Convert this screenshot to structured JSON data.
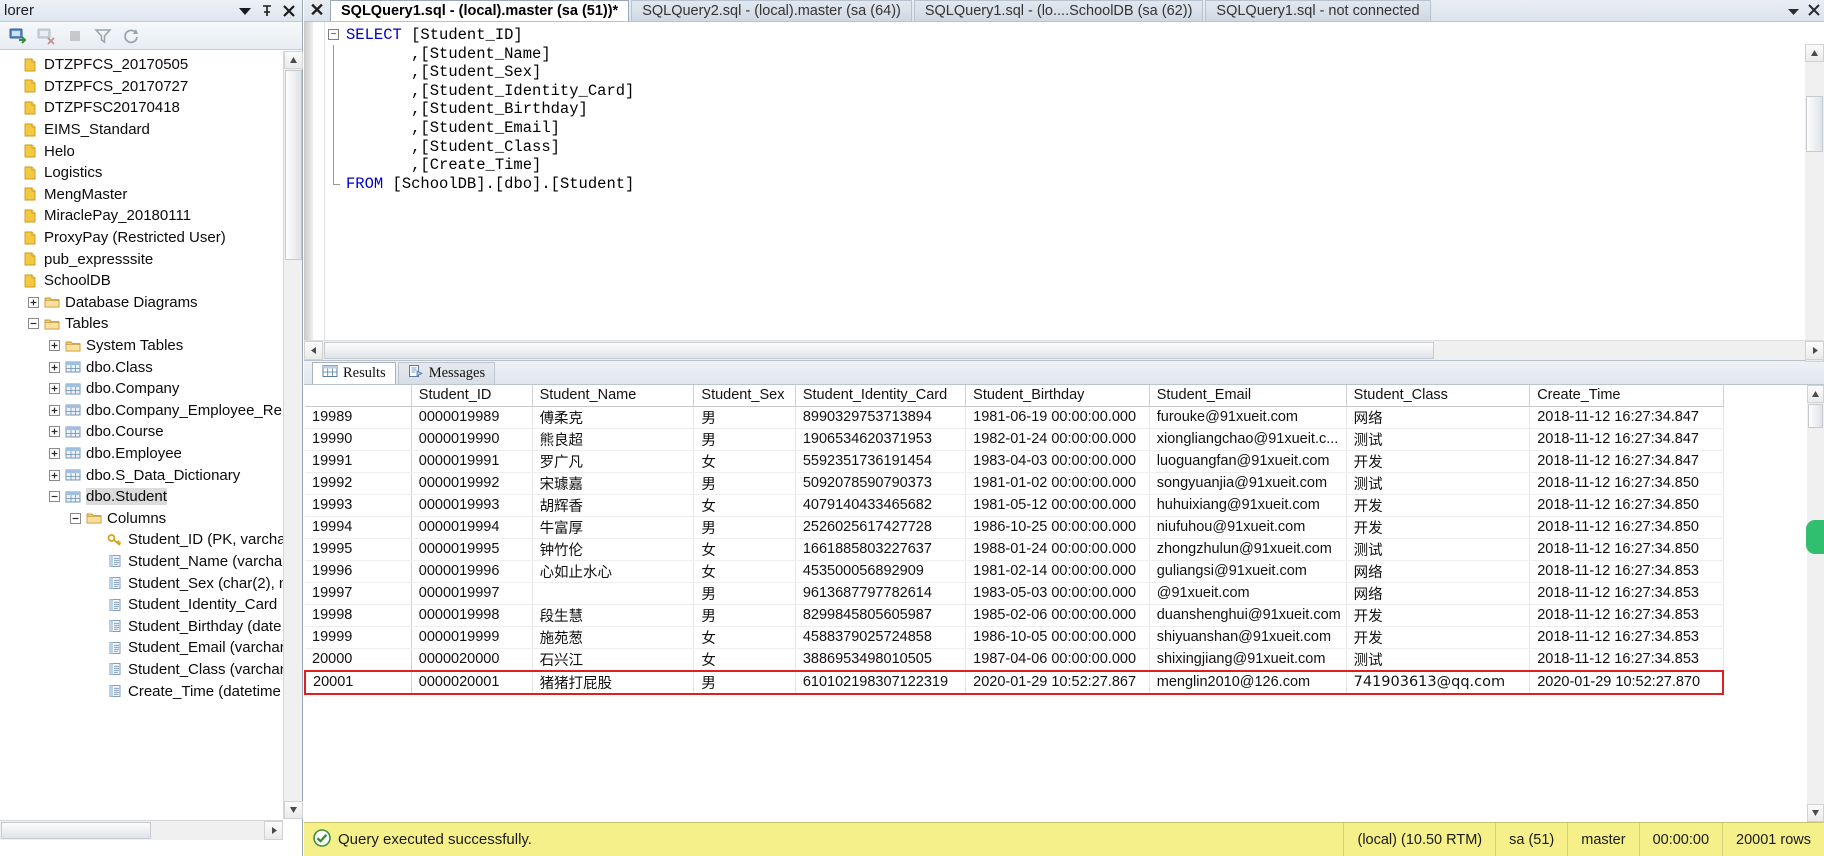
{
  "explorer": {
    "title": "lorer",
    "title_buttons": [
      "dropdown-icon",
      "pin-icon",
      "close-icon"
    ],
    "toolbar_buttons": [
      "connect-icon",
      "disconnect-icon",
      "stop-icon",
      "filter-icon",
      "refresh-icon"
    ],
    "tree": [
      {
        "label": "DTZPFCS_20170505",
        "icon": "database-icon",
        "indent": 0,
        "expander": "none"
      },
      {
        "label": "DTZPFCS_20170727",
        "icon": "database-icon",
        "indent": 0,
        "expander": "none"
      },
      {
        "label": "DTZPFSC20170418",
        "icon": "database-icon",
        "indent": 0,
        "expander": "none"
      },
      {
        "label": "EIMS_Standard",
        "icon": "database-icon",
        "indent": 0,
        "expander": "none"
      },
      {
        "label": "Helo",
        "icon": "database-icon",
        "indent": 0,
        "expander": "none"
      },
      {
        "label": "Logistics",
        "icon": "database-icon",
        "indent": 0,
        "expander": "none"
      },
      {
        "label": "MengMaster",
        "icon": "database-icon",
        "indent": 0,
        "expander": "none"
      },
      {
        "label": "MiraclePay_20180111",
        "icon": "database-icon",
        "indent": 0,
        "expander": "none"
      },
      {
        "label": "ProxyPay (Restricted User)",
        "icon": "database-icon",
        "indent": 0,
        "expander": "none"
      },
      {
        "label": "pub_expresssite",
        "icon": "database-icon",
        "indent": 0,
        "expander": "none"
      },
      {
        "label": "SchoolDB",
        "icon": "database-icon",
        "indent": 0,
        "expander": "none"
      },
      {
        "label": "Database Diagrams",
        "icon": "folder-icon",
        "indent": 1,
        "expander": "plus"
      },
      {
        "label": "Tables",
        "icon": "folder-icon",
        "indent": 1,
        "expander": "minus"
      },
      {
        "label": "System Tables",
        "icon": "folder-icon",
        "indent": 2,
        "expander": "plus"
      },
      {
        "label": "dbo.Class",
        "icon": "table-icon",
        "indent": 2,
        "expander": "plus"
      },
      {
        "label": "dbo.Company",
        "icon": "table-icon",
        "indent": 2,
        "expander": "plus"
      },
      {
        "label": "dbo.Company_Employee_Rel",
        "icon": "table-icon",
        "indent": 2,
        "expander": "plus"
      },
      {
        "label": "dbo.Course",
        "icon": "table-icon",
        "indent": 2,
        "expander": "plus"
      },
      {
        "label": "dbo.Employee",
        "icon": "table-icon",
        "indent": 2,
        "expander": "plus"
      },
      {
        "label": "dbo.S_Data_Dictionary",
        "icon": "table-icon",
        "indent": 2,
        "expander": "plus"
      },
      {
        "label": "dbo.Student",
        "icon": "table-icon",
        "indent": 2,
        "expander": "minus",
        "selected": true
      },
      {
        "label": "Columns",
        "icon": "folder-icon",
        "indent": 3,
        "expander": "minus"
      },
      {
        "label": "Student_ID (PK, varcha",
        "icon": "key-icon",
        "indent": 4,
        "expander": "none"
      },
      {
        "label": "Student_Name (varcha",
        "icon": "column-icon",
        "indent": 4,
        "expander": "none"
      },
      {
        "label": "Student_Sex (char(2), n",
        "icon": "column-icon",
        "indent": 4,
        "expander": "none"
      },
      {
        "label": "Student_Identity_Card",
        "icon": "column-icon",
        "indent": 4,
        "expander": "none"
      },
      {
        "label": "Student_Birthday (date",
        "icon": "column-icon",
        "indent": 4,
        "expander": "none"
      },
      {
        "label": "Student_Email (varchar",
        "icon": "column-icon",
        "indent": 4,
        "expander": "none"
      },
      {
        "label": "Student_Class (varchar",
        "icon": "column-icon",
        "indent": 4,
        "expander": "none"
      },
      {
        "label": "Create_Time (datetime",
        "icon": "column-icon",
        "indent": 4,
        "expander": "none"
      }
    ]
  },
  "tabs": {
    "close_label": "✕",
    "items": [
      {
        "label": "SQLQuery1.sql - (local).master (sa (51))*",
        "active": true
      },
      {
        "label": "SQLQuery2.sql - (local).master (sa (64))",
        "active": false
      },
      {
        "label": "SQLQuery1.sql - (lo....SchoolDB (sa (62))",
        "active": false
      },
      {
        "label": "SQLQuery1.sql - not connected",
        "active": false
      }
    ]
  },
  "editor": {
    "lines": [
      {
        "kw": "SELECT",
        "text": " [Student_ID]",
        "fold": "start",
        "changed": true
      },
      {
        "kw": "",
        "text": "       ,[Student_Name]",
        "fold": "bar",
        "changed": false
      },
      {
        "kw": "",
        "text": "       ,[Student_Sex]",
        "fold": "bar",
        "changed": false
      },
      {
        "kw": "",
        "text": "       ,[Student_Identity_Card]",
        "fold": "bar",
        "changed": false
      },
      {
        "kw": "",
        "text": "       ,[Student_Birthday]",
        "fold": "bar",
        "changed": false
      },
      {
        "kw": "",
        "text": "       ,[Student_Email]",
        "fold": "bar",
        "changed": false
      },
      {
        "kw": "",
        "text": "       ,[Student_Class]",
        "fold": "bar",
        "changed": false
      },
      {
        "kw": "",
        "text": "       ,[Create_Time]",
        "fold": "bar",
        "changed": false
      },
      {
        "kw": "FROM",
        "text": " [SchoolDB].[dbo].[Student]",
        "fold": "end",
        "changed": true
      }
    ]
  },
  "results": {
    "tabs": [
      {
        "label": "Results",
        "icon": "grid-icon",
        "active": true
      },
      {
        "label": "Messages",
        "icon": "messages-icon",
        "active": false
      }
    ],
    "columns": [
      "",
      "Student_ID",
      "Student_Name",
      "Student_Sex",
      "Student_Identity_Card",
      "Student_Birthday",
      "Student_Email",
      "Student_Class",
      "Create_Time"
    ],
    "rows": [
      [
        "19989",
        "0000019989",
        "傅柔克",
        "男",
        "8990329753713894",
        "1981-06-19 00:00:00.000",
        "furouke@91xueit.com",
        "网络",
        "2018-11-12 16:27:34.847"
      ],
      [
        "19990",
        "0000019990",
        "熊良超",
        "男",
        "1906534620371953",
        "1982-01-24 00:00:00.000",
        "xiongliangchao@91xueit.c...",
        "测试",
        "2018-11-12 16:27:34.847"
      ],
      [
        "19991",
        "0000019991",
        "罗广凡",
        "女",
        "5592351736191454",
        "1983-04-03 00:00:00.000",
        "luoguangfan@91xueit.com",
        "开发",
        "2018-11-12 16:27:34.847"
      ],
      [
        "19992",
        "0000019992",
        "宋璩嘉",
        "男",
        "5092078590790373",
        "1981-01-02 00:00:00.000",
        "songyuanjia@91xueit.com",
        "测试",
        "2018-11-12 16:27:34.850"
      ],
      [
        "19993",
        "0000019993",
        "胡辉香",
        "女",
        "4079140433465682",
        "1981-05-12 00:00:00.000",
        "huhuixiang@91xueit.com",
        "开发",
        "2018-11-12 16:27:34.850"
      ],
      [
        "19994",
        "0000019994",
        "牛富厚",
        "男",
        "2526025617427728",
        "1986-10-25 00:00:00.000",
        "niufuhou@91xueit.com",
        "开发",
        "2018-11-12 16:27:34.850"
      ],
      [
        "19995",
        "0000019995",
        "钟竹伦",
        "女",
        "1661885803227637",
        "1988-01-24 00:00:00.000",
        "zhongzhulun@91xueit.com",
        "测试",
        "2018-11-12 16:27:34.850"
      ],
      [
        "19996",
        "0000019996",
        "心如止水心",
        "女",
        "453500056892909",
        "1981-02-14 00:00:00.000",
        "guliangsi@91xueit.com",
        "网络",
        "2018-11-12 16:27:34.853"
      ],
      [
        "19997",
        "0000019997",
        "",
        "男",
        "9613687797782614",
        "1983-05-03 00:00:00.000",
        "@91xueit.com",
        "网络",
        "2018-11-12 16:27:34.853"
      ],
      [
        "19998",
        "0000019998",
        "段生慧",
        "男",
        "8299845805605987",
        "1985-02-06 00:00:00.000",
        "duanshenghui@91xueit.com",
        "开发",
        "2018-11-12 16:27:34.853"
      ],
      [
        "19999",
        "0000019999",
        "施苑葱",
        "女",
        "4588379025724858",
        "1986-10-05 00:00:00.000",
        "shiyuanshan@91xueit.com",
        "开发",
        "2018-11-12 16:27:34.853"
      ],
      [
        "20000",
        "0000020000",
        "石兴江",
        "女",
        "3886953498010505",
        "1987-04-06 00:00:00.000",
        "shixingjiang@91xueit.com",
        "测试",
        "2018-11-12 16:27:34.853"
      ],
      [
        "20001",
        "0000020001",
        "猪猪打屁股",
        "男",
        "610102198307122319",
        "2020-01-29 10:52:27.867",
        "menglin2010@126.com",
        "741903613@qq.com",
        "2020-01-29 10:52:27.870"
      ]
    ],
    "highlight_row_index": 12,
    "highlight_color": "#e02020"
  },
  "statusbar": {
    "message": "Query executed successfully.",
    "status_icon": "success-check-icon",
    "items": [
      "(local) (10.50 RTM)",
      "sa (51)",
      "master",
      "00:00:00",
      "20001 rows"
    ],
    "background": "#f6f08a"
  }
}
